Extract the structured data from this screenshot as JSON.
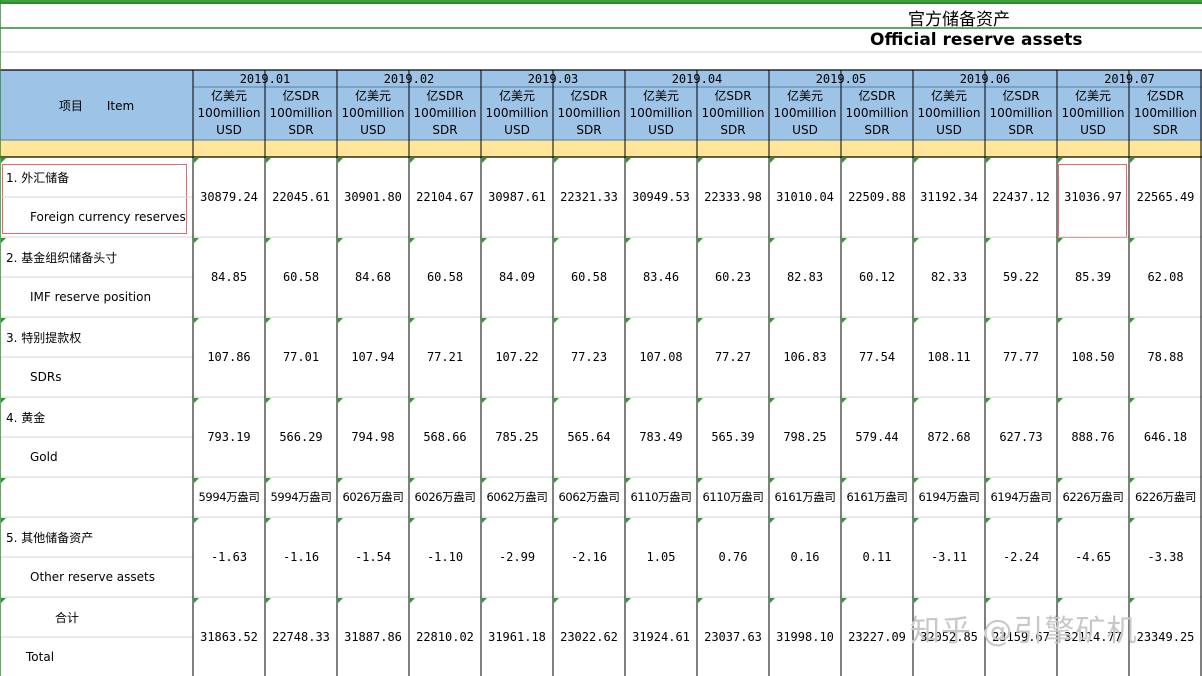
{
  "title": {
    "zh": "官方储备资产",
    "en": "Official reserve assets"
  },
  "header": {
    "item_label": "项目　　Item",
    "months": [
      "2019.01",
      "2019.02",
      "2019.03",
      "2019.04",
      "2019.05",
      "2019.06",
      "2019.07"
    ],
    "usd_label": [
      "亿美元",
      "100million",
      "USD"
    ],
    "sdr_label": [
      "亿SDR",
      "100million",
      "SDR"
    ]
  },
  "rows": [
    {
      "zh": "1.  外汇储备",
      "en": "Foreign currency reserves",
      "values": [
        "30879.24",
        "22045.61",
        "30901.80",
        "22104.67",
        "30987.61",
        "22321.33",
        "30949.53",
        "22333.98",
        "31010.04",
        "22509.88",
        "31192.34",
        "22437.12",
        "31036.97",
        "22565.49"
      ]
    },
    {
      "zh": "2.  基金组织储备头寸",
      "en": "IMF reserve position",
      "values": [
        "84.85",
        "60.58",
        "84.68",
        "60.58",
        "84.09",
        "60.58",
        "83.46",
        "60.23",
        "82.83",
        "60.12",
        "82.33",
        "59.22",
        "85.39",
        "62.08"
      ]
    },
    {
      "zh": "3.  特别提款权",
      "en": "SDRs",
      "values": [
        "107.86",
        "77.01",
        "107.94",
        "77.21",
        "107.22",
        "77.23",
        "107.08",
        "77.27",
        "106.83",
        "77.54",
        "108.11",
        "77.77",
        "108.50",
        "78.88"
      ]
    },
    {
      "zh": "4.  黄金",
      "en": "Gold",
      "values": [
        "793.19",
        "566.29",
        "794.98",
        "568.66",
        "785.25",
        "565.64",
        "783.49",
        "565.39",
        "798.25",
        "579.44",
        "872.68",
        "627.73",
        "888.76",
        "646.18"
      ]
    },
    {
      "zh": "",
      "en": "",
      "values": [
        "5994万盎司",
        "5994万盎司",
        "6026万盎司",
        "6026万盎司",
        "6062万盎司",
        "6062万盎司",
        "6110万盎司",
        "6110万盎司",
        "6161万盎司",
        "6161万盎司",
        "6194万盎司",
        "6194万盎司",
        "6226万盎司",
        "6226万盎司"
      ]
    },
    {
      "zh": "5.  其他储备资产",
      "en": "Other reserve assets",
      "values": [
        "-1.63",
        "-1.16",
        "-1.54",
        "-1.10",
        "-2.99",
        "-2.16",
        "1.05",
        "0.76",
        "0.16",
        "0.11",
        "-3.11",
        "-2.24",
        "-4.65",
        "-3.38"
      ]
    },
    {
      "zh": "合计",
      "en": "Total",
      "values": [
        "31863.52",
        "22748.33",
        "31887.86",
        "22810.02",
        "31961.18",
        "23022.62",
        "31924.61",
        "23037.63",
        "31998.10",
        "23227.09",
        "32052.85",
        "23159.67",
        "32114.77",
        "23349.25"
      ]
    }
  ],
  "watermark": "知乎 @引擎矿机",
  "colors": {
    "header_bg": "#9dc3e6",
    "band_bg": "#ffe699",
    "accent_green": "#2b9a2b",
    "highlight": "#e26a6a"
  }
}
